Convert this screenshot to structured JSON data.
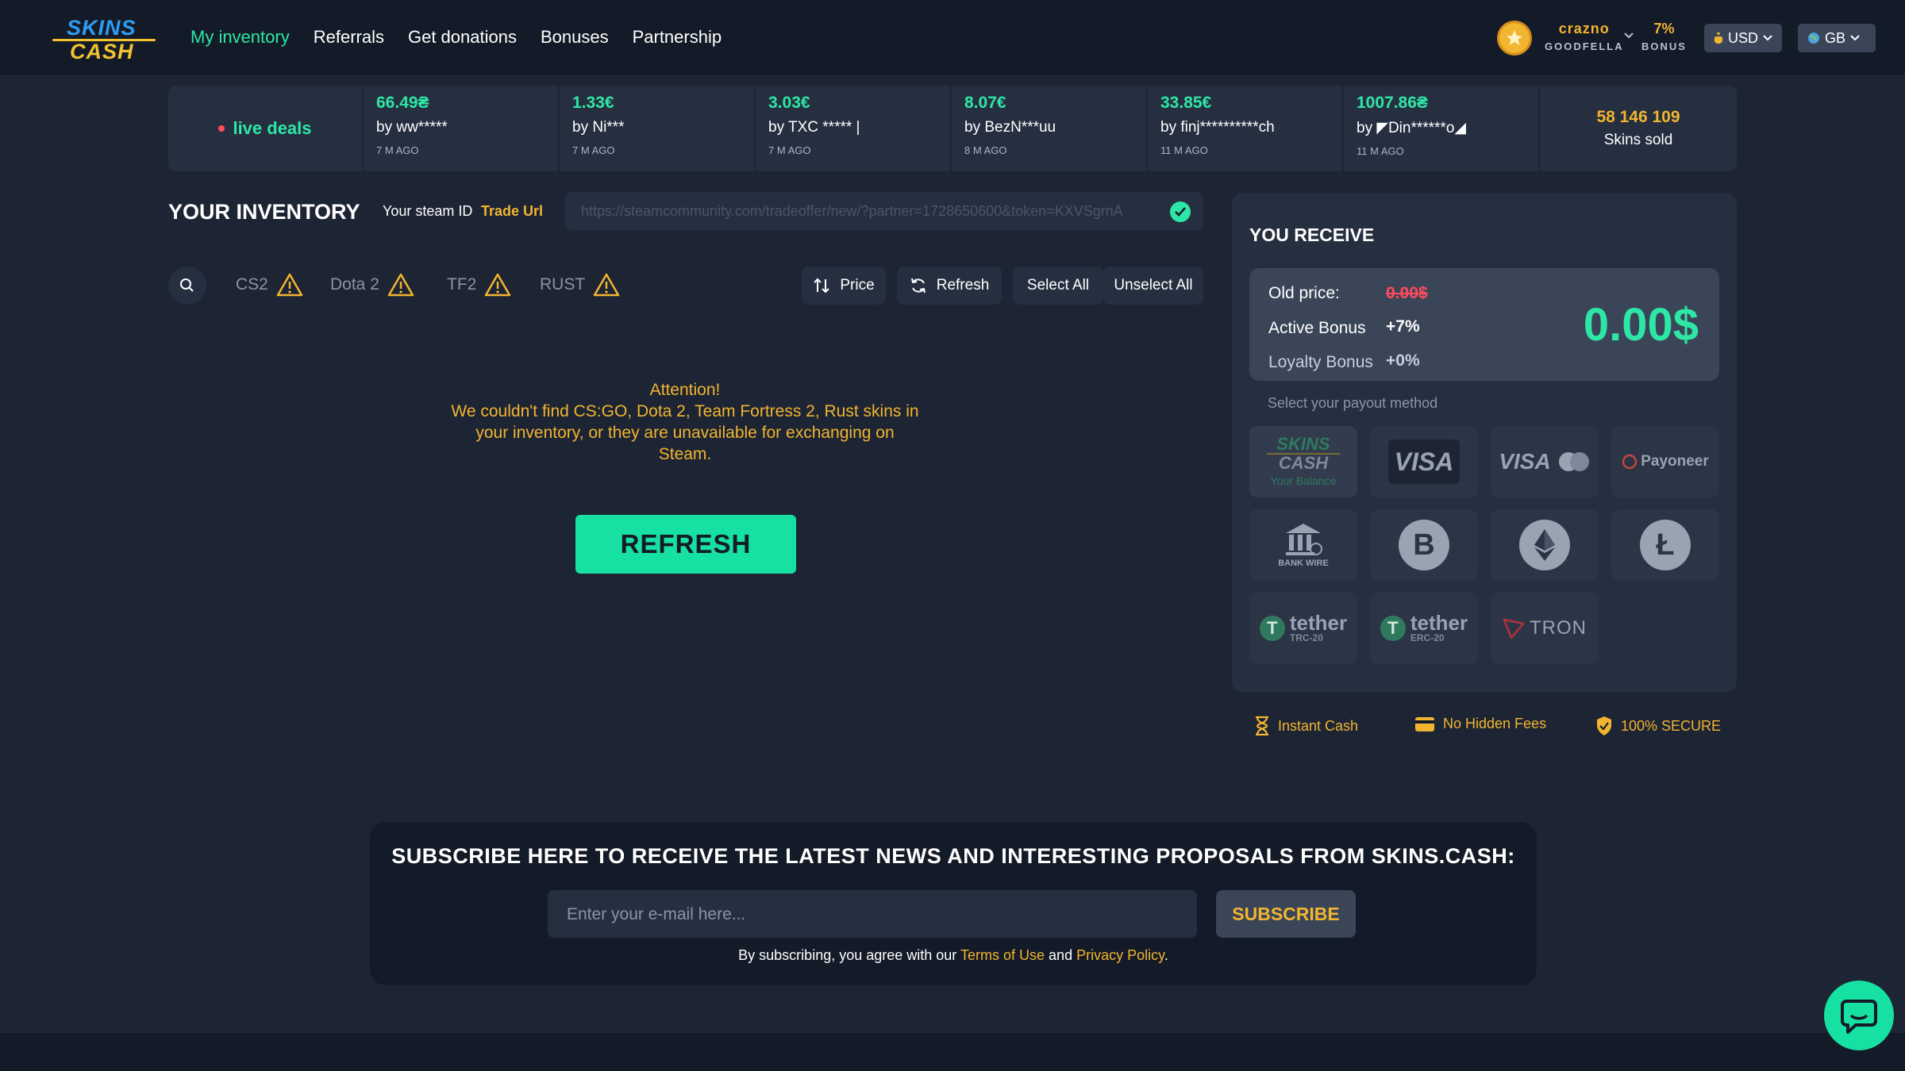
{
  "header": {
    "logo_top": "SKINS",
    "logo_bottom": "CASH",
    "nav": [
      {
        "label": "My inventory",
        "active": true
      },
      {
        "label": "Referrals"
      },
      {
        "label": "Get donations"
      },
      {
        "label": "Bonuses"
      },
      {
        "label": "Partnership"
      }
    ],
    "user": {
      "name": "crazno",
      "rank": "GOODFELLA"
    },
    "bonus": {
      "percent": "7%",
      "label": "BONUS"
    },
    "currency": "USD",
    "language": "GB"
  },
  "live_deals": {
    "label": "live deals",
    "deals": [
      {
        "price": "66.49₴",
        "by": "by ww*****",
        "ago": "7 M AGO"
      },
      {
        "price": "1.33€",
        "by": "by Ni***",
        "ago": "7 M AGO"
      },
      {
        "price": "3.03€",
        "by": "by TXC ***** |",
        "ago": "7 M AGO"
      },
      {
        "price": "8.07€",
        "by": "by BezN***uu",
        "ago": "8 M AGO"
      },
      {
        "price": "33.85€",
        "by": "by finj**********ch",
        "ago": "11 M AGO"
      },
      {
        "price": "1007.86₴",
        "by": "by ◤Din******o◢",
        "ago": "11 M AGO"
      }
    ],
    "skins_sold_count": "58 146 109",
    "skins_sold_label": "Skins sold"
  },
  "inventory": {
    "title": "YOUR INVENTORY",
    "steam_id_label": "Your steam ID",
    "trade_url_label": "Trade Url",
    "trade_url_value": "https://steamcommunity.com/tradeoffer/new/?partner=1728650600&token=KXVSgrnA",
    "games": [
      "CS2",
      "Dota 2",
      "TF2",
      "RUST"
    ],
    "tools": {
      "price": "Price",
      "refresh": "Refresh",
      "select_all": "Select All",
      "unselect_all": "Unselect All"
    },
    "attention_title": "Attention!",
    "attention_text": "We couldn't find CS:GO, Dota 2, Team Fortress 2, Rust skins in your inventory, or they are unavailable for exchanging on Steam.",
    "refresh_button": "REFRESH"
  },
  "receive": {
    "title": "YOU RECEIVE",
    "old_price_label": "Old price:",
    "old_price_value": "0.00$",
    "active_bonus_label": "Active Bonus",
    "active_bonus_value": "+7%",
    "loyalty_bonus_label": "Loyalty Bonus",
    "loyalty_bonus_value": "+0%",
    "total": "0.00$",
    "payout_label": "Select your payout method",
    "methods": {
      "skins_top": "SKINS",
      "skins_bottom": "CASH",
      "skins_sub": "Your Balance",
      "visa": "VISA",
      "visa_mc": "VISA",
      "payoneer": "Payoneer",
      "bank_wire": "BANK WIRE",
      "bitcoin": "B",
      "litecoin": "Ł",
      "tether_word": "tether",
      "tether_trc": "TRC-20",
      "tether_erc": "ERC-20",
      "tron": "TRON"
    }
  },
  "features": [
    "Instant Cash",
    "No Hidden Fees",
    "100% SECURE"
  ],
  "subscribe": {
    "title": "SUBSCRIBE HERE TO RECEIVE THE LATEST NEWS AND INTERESTING PROPOSALS FROM SKINS.CASH:",
    "placeholder": "Enter your e-mail here...",
    "button": "SUBSCRIBE",
    "note_prefix": "By subscribing, you agree with our",
    "terms": "Terms of Use",
    "and": "and",
    "privacy": "Privacy Policy",
    "period": "."
  },
  "colors": {
    "accent": "#2ee6a6",
    "gold": "#f2b530",
    "danger": "#ff4b5c",
    "bg": "#1d2433",
    "panel": "#262f40"
  }
}
